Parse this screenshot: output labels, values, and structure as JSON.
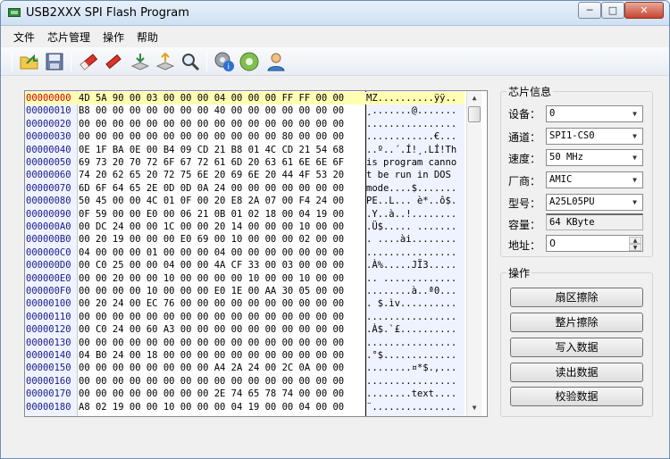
{
  "window": {
    "title": "USB2XXX SPI Flash Program",
    "min": "─",
    "max": "□",
    "close": "✕"
  },
  "menu": [
    "文件",
    "芯片管理",
    "操作",
    "帮助"
  ],
  "toolbar": {
    "buttons": [
      "open-folder-icon",
      "save-icon",
      "erase-icon",
      "eraser-icon",
      "download-icon",
      "upload-icon",
      "search-icon",
      "settings-info-icon",
      "gear-icon",
      "user-icon"
    ]
  },
  "hex": {
    "rows": [
      {
        "addr": "00000000",
        "bytes": "4D 5A 90 00 03 00 00 00 04 00 00 00 FF FF 00 00",
        "ascii": "MZ..........ÿÿ.."
      },
      {
        "addr": "00000010",
        "bytes": "B8 00 00 00 00 00 00 00 40 00 00 00 00 00 00 00",
        "ascii": "¸.......@......."
      },
      {
        "addr": "00000020",
        "bytes": "00 00 00 00 00 00 00 00 00 00 00 00 00 00 00 00",
        "ascii": "................"
      },
      {
        "addr": "00000030",
        "bytes": "00 00 00 00 00 00 00 00 00 00 00 00 80 00 00 00",
        "ascii": "............€..."
      },
      {
        "addr": "00000040",
        "bytes": "0E 1F BA 0E 00 B4 09 CD 21 B8 01 4C CD 21 54 68",
        "ascii": "..º..´.Í!¸.LÍ!Th"
      },
      {
        "addr": "00000050",
        "bytes": "69 73 20 70 72 6F 67 72 61 6D 20 63 61 6E 6E 6F",
        "ascii": "is program canno"
      },
      {
        "addr": "00000060",
        "bytes": "74 20 62 65 20 72 75 6E 20 69 6E 20 44 4F 53 20",
        "ascii": "t be run in DOS "
      },
      {
        "addr": "00000070",
        "bytes": "6D 6F 64 65 2E 0D 0D 0A 24 00 00 00 00 00 00 00",
        "ascii": "mode....$......."
      },
      {
        "addr": "00000080",
        "bytes": "50 45 00 00 4C 01 0F 00 20 E8 2A 07 00 F4 24 00",
        "ascii": "PE..L... è*..ô$."
      },
      {
        "addr": "00000090",
        "bytes": "0F 59 00 00 E0 00 06 21 0B 01 02 18 00 04 19 00",
        "ascii": ".Y..à..!........"
      },
      {
        "addr": "000000A0",
        "bytes": "00 DC 24 00 00 1C 00 00 20 14 00 00 00 10 00 00",
        "ascii": ".Ü$..... ......."
      },
      {
        "addr": "000000B0",
        "bytes": "00 20 19 00 00 00 E0 69 00 10 00 00 00 02 00 00",
        "ascii": ". ....ài........"
      },
      {
        "addr": "000000C0",
        "bytes": "04 00 00 00 01 00 00 00 04 00 00 00 00 00 00 00",
        "ascii": "................"
      },
      {
        "addr": "000000D0",
        "bytes": "00 C0 25 00 00 04 00 00 4A CF 33 00 03 00 00 00",
        "ascii": ".À%.....JÏ3....."
      },
      {
        "addr": "000000E0",
        "bytes": "00 00 20 00 00 10 00 00 00 00 10 00 00 10 00 00",
        "ascii": ".. ............."
      },
      {
        "addr": "000000F0",
        "bytes": "00 00 00 00 10 00 00 00 E0 1E 00 AA 30 05 00 00",
        "ascii": "........à..ª0..."
      },
      {
        "addr": "00000100",
        "bytes": "00 20 24 00 EC 76 00 00 00 00 00 00 00 00 00 00",
        "ascii": ". $.ìv.........."
      },
      {
        "addr": "00000110",
        "bytes": "00 00 00 00 00 00 00 00 00 00 00 00 00 00 00 00",
        "ascii": "................"
      },
      {
        "addr": "00000120",
        "bytes": "00 C0 24 00 60 A3 00 00 00 00 00 00 00 00 00 00",
        "ascii": ".À$.`£.........."
      },
      {
        "addr": "00000130",
        "bytes": "00 00 00 00 00 00 00 00 00 00 00 00 00 00 00 00",
        "ascii": "................"
      },
      {
        "addr": "00000140",
        "bytes": "04 B0 24 00 18 00 00 00 00 00 00 00 00 00 00 00",
        "ascii": ".°$............."
      },
      {
        "addr": "00000150",
        "bytes": "00 00 00 00 00 00 00 00 A4 2A 24 00 2C 0A 00 00",
        "ascii": "........¤*$.,..."
      },
      {
        "addr": "00000160",
        "bytes": "00 00 00 00 00 00 00 00 00 00 00 00 00 00 00 00",
        "ascii": "................"
      },
      {
        "addr": "00000170",
        "bytes": "00 00 00 00 00 00 00 00 2E 74 65 78 74 00 00 00",
        "ascii": "........text...."
      },
      {
        "addr": "00000180",
        "bytes": "A8 02 19 00 00 10 00 00 00 04 19 00 00 04 00 00",
        "ascii": "¨..............."
      }
    ]
  },
  "chip_info": {
    "title": "芯片信息",
    "device_label": "设备：",
    "device_value": "0",
    "channel_label": "通道：",
    "channel_value": "SPI1-CS0",
    "speed_label": "速度：",
    "speed_value": "50 MHz",
    "vendor_label": "厂商：",
    "vendor_value": "AMIC",
    "model_label": "型号：",
    "model_value": "A25L05PU",
    "capacity_label": "容量：",
    "capacity_value": "64 KByte",
    "address_label": "地址：",
    "address_value": "0"
  },
  "operations": {
    "title": "操作",
    "sector_erase": "扇区擦除",
    "chip_erase": "整片擦除",
    "write_data": "写入数据",
    "read_data": "读出数据",
    "verify_data": "校验数据"
  }
}
